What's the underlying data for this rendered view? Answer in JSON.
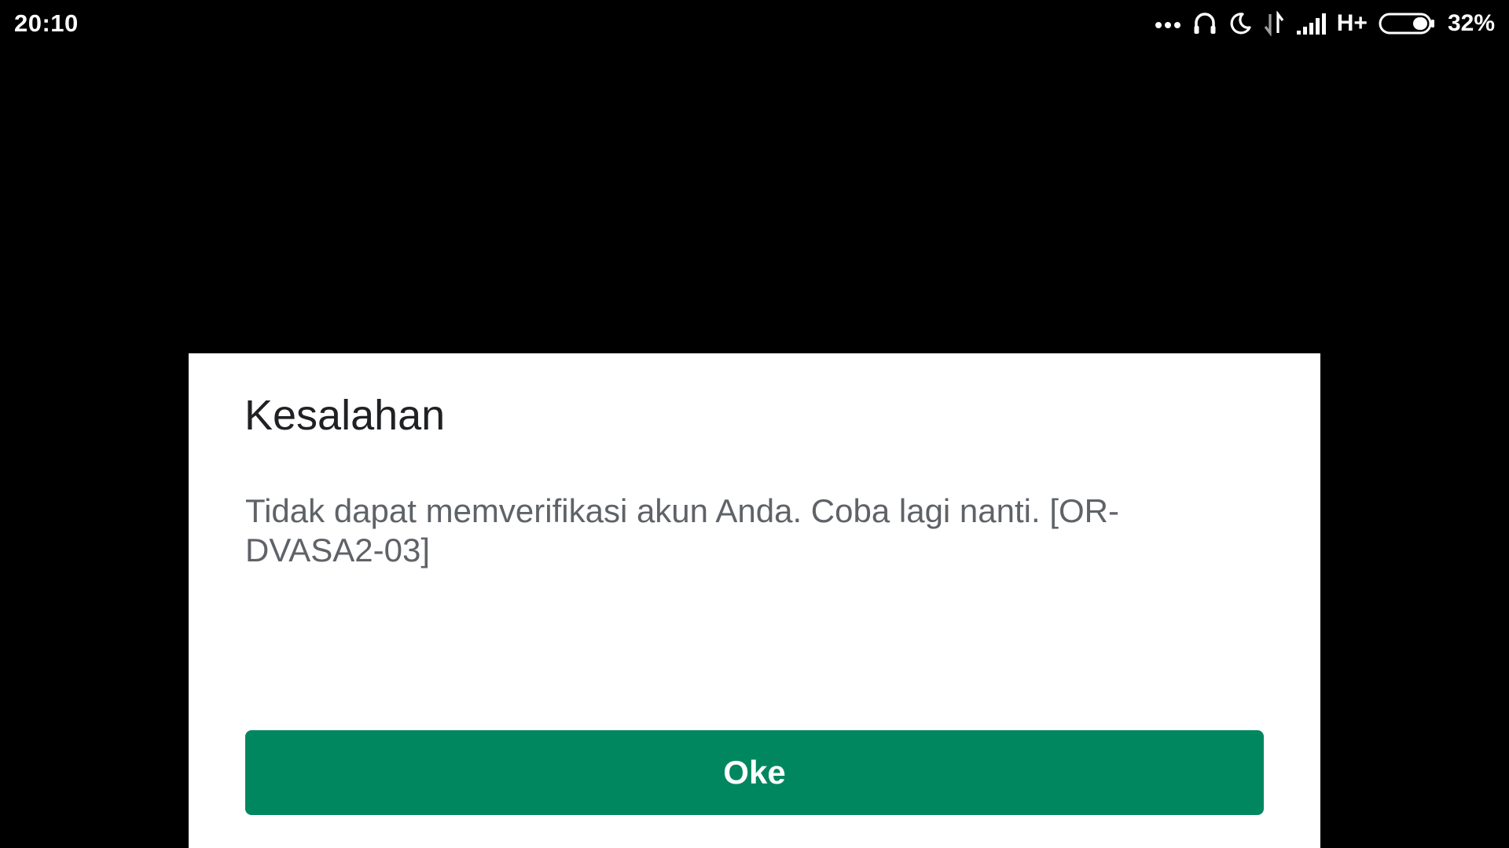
{
  "status_bar": {
    "time": "20:10",
    "network_type": "H+",
    "battery_percent": "32%",
    "battery_level": 0.32,
    "icons": [
      "more-dots-icon",
      "headset-icon",
      "moon-icon",
      "data-arrows-icon",
      "signal-icon",
      "battery-icon"
    ]
  },
  "dialog": {
    "title": "Kesalahan",
    "message": "Tidak dapat memverifikasi akun Anda. Coba lagi nanti. [OR-DVASA2-03]",
    "ok_label": "Oke"
  },
  "colors": {
    "background": "#000000",
    "dialog_background": "#ffffff",
    "title_text": "#202124",
    "message_text": "#5f6368",
    "button": "#01875f",
    "button_text": "#ffffff"
  }
}
